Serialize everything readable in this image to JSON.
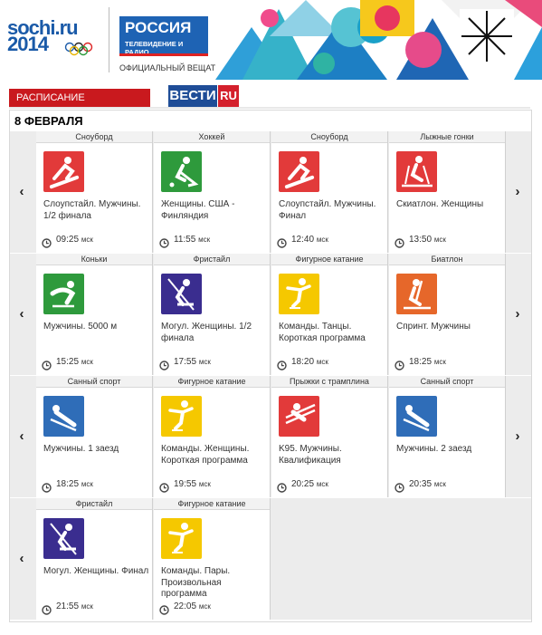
{
  "header": {
    "sochi_line1": "sochi.ru",
    "sochi_line2": "2014",
    "rossiya_title": "РОССИЯ",
    "rossiya_subtitle": "ТЕЛЕВИДЕНИЕ И РАДИО",
    "official_broadcaster": "ОФИЦИАЛЬНЫЙ ВЕЩАТЕЛЬ"
  },
  "tab": {
    "label": "РАСПИСАНИЕ ТРАНСЛЯЦИЙ"
  },
  "vesti": {
    "part1": "ВЕСТИ",
    "part2": "RU"
  },
  "date": "8 ФЕВРАЛЯ",
  "nav": {
    "prev": "‹",
    "next": "›"
  },
  "time_unit": "мск",
  "colors": {
    "red": "#e23a3a",
    "green": "#2e9a3c",
    "orange": "#e6672a",
    "purple": "#3a2d8f",
    "yellow": "#f5c800",
    "blue": "#2f6db8"
  },
  "rows": [
    {
      "cards": [
        {
          "sport": "Сноуборд",
          "event": "Слоупстайл. Мужчины. 1/2 финала",
          "time": "09:25",
          "color": "#e23a3a",
          "icon": "snowboard-icon"
        },
        {
          "sport": "Хоккей",
          "event": "Женщины. США - Финляндия",
          "time": "11:55",
          "color": "#2e9a3c",
          "icon": "hockey-icon"
        },
        {
          "sport": "Сноуборд",
          "event": "Слоупстайл. Мужчины. Финал",
          "time": "12:40",
          "color": "#e23a3a",
          "icon": "snowboard-icon"
        },
        {
          "sport": "Лыжные гонки",
          "event": "Скиатлон. Женщины",
          "time": "13:50",
          "color": "#e23a3a",
          "icon": "cross-country-icon"
        }
      ]
    },
    {
      "cards": [
        {
          "sport": "Коньки",
          "event": "Мужчины. 5000 м",
          "time": "15:25",
          "color": "#2e9a3c",
          "icon": "speed-skating-icon"
        },
        {
          "sport": "Фристайл",
          "event": "Могул. Женщины. 1/2 финала",
          "time": "17:55",
          "color": "#3a2d8f",
          "icon": "freestyle-icon"
        },
        {
          "sport": "Фигурное катание",
          "event": "Команды. Танцы. Короткая программа",
          "time": "18:20",
          "color": "#f5c800",
          "icon": "figure-skating-icon"
        },
        {
          "sport": "Биатлон",
          "event": "Спринт. Мужчины",
          "time": "18:25",
          "color": "#e6672a",
          "icon": "biathlon-icon"
        }
      ]
    },
    {
      "cards": [
        {
          "sport": "Санный спорт",
          "event": "Мужчины. 1 заезд",
          "time": "18:25",
          "color": "#2f6db8",
          "icon": "luge-icon"
        },
        {
          "sport": "Фигурное катание",
          "event": "Команды. Женщины. Короткая программа",
          "time": "19:55",
          "color": "#f5c800",
          "icon": "figure-skating-icon"
        },
        {
          "sport": "Прыжки с трамплина",
          "event": "K95. Мужчины. Квалификация",
          "time": "20:25",
          "color": "#e23a3a",
          "icon": "ski-jumping-icon"
        },
        {
          "sport": "Санный спорт",
          "event": "Мужчины. 2 заезд",
          "time": "20:35",
          "color": "#2f6db8",
          "icon": "luge-icon"
        }
      ]
    },
    {
      "cards": [
        {
          "sport": "Фристайл",
          "event": "Могул. Женщины. Финал",
          "time": "21:55",
          "color": "#3a2d8f",
          "icon": "freestyle-icon"
        },
        {
          "sport": "Фигурное катание",
          "event": "Команды. Пары. Произвольная программа",
          "time": "22:05",
          "color": "#f5c800",
          "icon": "figure-skating-icon"
        }
      ]
    }
  ]
}
